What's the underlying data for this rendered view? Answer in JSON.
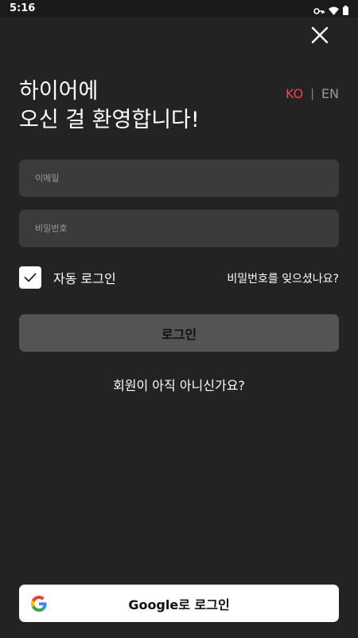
{
  "status_bar": {
    "time": "5:16",
    "icons": [
      "key-icon",
      "wifi-icon",
      "battery-icon"
    ]
  },
  "close_icon": "close-icon",
  "headline": {
    "line1": "하이어에",
    "line2": "오신 걸 환영합니다!"
  },
  "language": {
    "ko": "KO",
    "separator": "|",
    "en": "EN",
    "selected": "KO",
    "accent_color": "#f2424a"
  },
  "form": {
    "email_placeholder": "이메일",
    "email_value": "",
    "password_placeholder": "비밀번호",
    "password_value": "",
    "auto_login_label": "자동 로그인",
    "auto_login_checked": true,
    "forgot_password": "비밀번호를 잊으셨나요?",
    "login_button": "로그인",
    "signup_prompt": "회원이 아직 아니신가요?"
  },
  "google": {
    "icon": "google-icon",
    "label": "Google로 로그인"
  },
  "colors": {
    "background": "#232323",
    "input_background": "#3b3b3b",
    "login_button": "#545454",
    "google_button": "#ffffff"
  }
}
